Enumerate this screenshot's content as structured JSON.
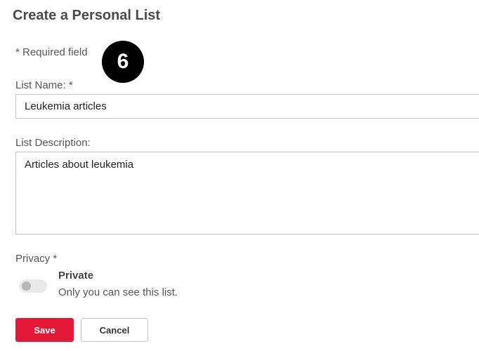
{
  "page": {
    "title": "Create a Personal List",
    "required_note": "* Required field",
    "step_number": "6"
  },
  "form": {
    "name_label": "List Name: *",
    "name_value": "Leukemia articles",
    "description_label": "List Description:",
    "description_value": "Articles about leukemia",
    "privacy_label": "Privacy *",
    "privacy_option_title": "Private",
    "privacy_option_description": "Only you can see this list.",
    "privacy_enabled": false
  },
  "actions": {
    "save_label": "Save",
    "cancel_label": "Cancel"
  },
  "colors": {
    "primary_button": "#e31837",
    "toggle_off_track": "#e9e9e9",
    "toggle_off_knob": "#b7b7b7",
    "badge_background": "#000000"
  }
}
